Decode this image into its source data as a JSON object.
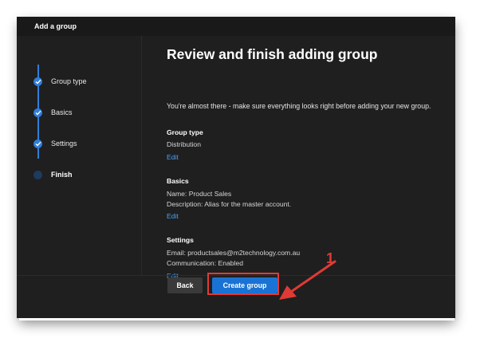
{
  "window": {
    "title": "Add a group"
  },
  "steps": [
    {
      "label": "Group type",
      "state": "complete"
    },
    {
      "label": "Basics",
      "state": "complete"
    },
    {
      "label": "Settings",
      "state": "complete"
    },
    {
      "label": "Finish",
      "state": "current"
    }
  ],
  "main": {
    "heading": "Review and finish adding group",
    "intro": "You're almost there - make sure everything looks right before adding your new group.",
    "sections": {
      "group_type": {
        "title": "Group type",
        "lines": [
          "Distribution"
        ],
        "edit": "Edit"
      },
      "basics": {
        "title": "Basics",
        "lines": [
          "Name: Product Sales",
          "Description: Alias for the master account."
        ],
        "edit": "Edit"
      },
      "settings": {
        "title": "Settings",
        "lines": [
          "Email: productsales@m2technology.com.au",
          "Communication: Enabled"
        ],
        "edit": "Edit"
      }
    }
  },
  "footer": {
    "back_label": "Back",
    "create_label": "Create group"
  },
  "annotation": {
    "number": "1",
    "color": "#e03a36"
  },
  "colors": {
    "accent": "#1a73d4",
    "link": "#4aa3f5",
    "background": "#1f1f1f"
  }
}
